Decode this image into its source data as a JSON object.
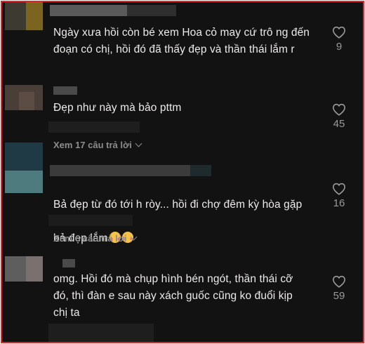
{
  "comments": [
    {
      "text": "Ngày xưa hồi còn bé xem Hoa cỏ may cứ trô ng đến\nđoạn có chị, hồi đó đã thấy đẹp và thần thái lắm r",
      "likes": "9"
    },
    {
      "text": "Đẹp như này mà bảo pttm",
      "likes": "45",
      "replies": "Xem 17 câu trả lời"
    },
    {
      "text_line1": "Bả đẹp từ đó tới h ròy... hồi đi chợ đêm kỳ hòa gặp",
      "text_line2": "bả đẹp lắm",
      "emoji": "smiling-face-icon",
      "likes": "16",
      "replies": "Xem 6 câu trả lời"
    },
    {
      "text": "omg. Hồi đó mà chụp hình bén ngót, thần thái cỡ\nđó, thì đàn e sau này xách guốc cũng ko đuổi kịp\nchị ta",
      "likes": "59"
    }
  ],
  "colors": {
    "background": "#121212",
    "border": "#e0262d",
    "text": "#ecebea",
    "muted": "#8d8d8d"
  },
  "icons": {
    "like": "heart-outline-icon",
    "expand": "chevron-down-icon"
  }
}
